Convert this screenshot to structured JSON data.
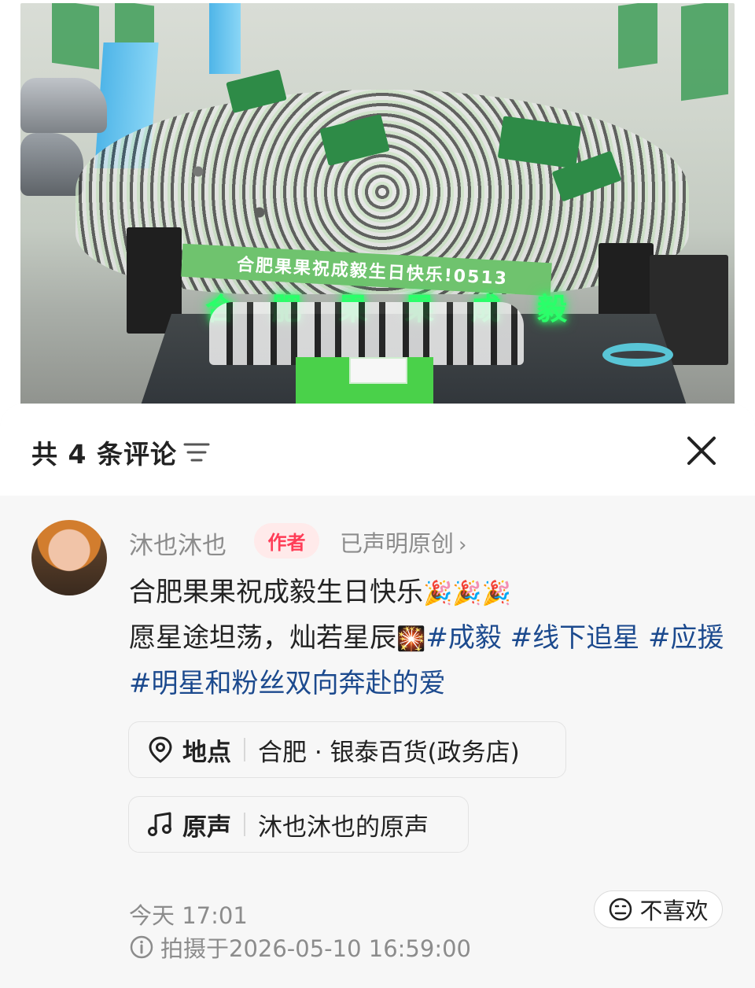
{
  "photo": {
    "stage_banner_text": "合肥果果祝成毅生日快乐!0513",
    "neon_sign_chars": [
      "合",
      "肥",
      "果",
      "果",
      "成",
      "毅"
    ]
  },
  "comments_header": {
    "count_label": "共 4 条评论"
  },
  "post": {
    "author_name": "沐也沐也",
    "author_tag": "作者",
    "original_label": "已声明原创",
    "body_line1_text": "合肥果果祝成毅生日快乐",
    "body_line1_emoji": "🎉🎉🎉",
    "body_line2_text": "愿星途坦荡，灿若星辰",
    "body_line2_emoji": "🎇",
    "hashtags": [
      "#成毅",
      "#线下追星",
      "#应援",
      "#明星和粉丝双向奔赴的爱"
    ],
    "location_label": "地点",
    "location_value": "合肥 · 银泰百货(政务店)",
    "music_label": "原声",
    "music_value": "沐也沐也的原声",
    "time": "今天 17:01",
    "shot_at": "拍摄于2026-05-10 16:59:00",
    "dislike_label": "不喜欢"
  },
  "colors": {
    "author_tag_text": "#ff3d57",
    "author_tag_bg": "#ffeaea",
    "hashtag": "#1c4a8e",
    "meta_gray": "#8c8c8c"
  },
  "icons": [
    "sort-icon",
    "close-icon",
    "chevron-right-icon",
    "location-pin-icon",
    "music-note-icon",
    "info-icon",
    "dislike-face-icon"
  ]
}
